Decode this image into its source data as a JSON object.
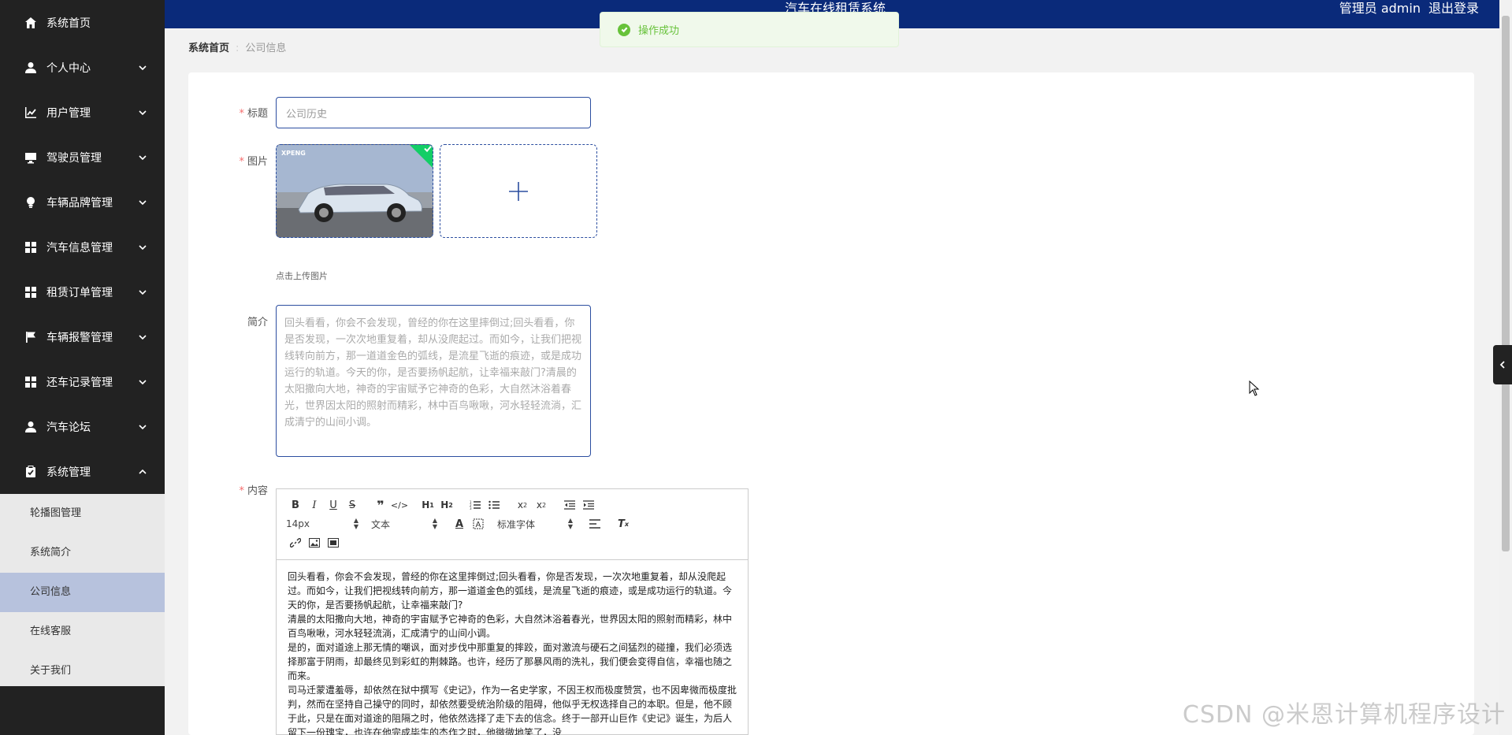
{
  "header": {
    "title": "汽车在线租赁系统",
    "user_label": "管理员 admin",
    "logout_label": "退出登录"
  },
  "sidebar": {
    "items": [
      {
        "label": "系统首页",
        "icon": "home-icon",
        "expandable": false
      },
      {
        "label": "个人中心",
        "icon": "user-icon",
        "expandable": true
      },
      {
        "label": "用户管理",
        "icon": "chart-icon",
        "expandable": true
      },
      {
        "label": "驾驶员管理",
        "icon": "monitor-icon",
        "expandable": true
      },
      {
        "label": "车辆品牌管理",
        "icon": "bulb-icon",
        "expandable": true
      },
      {
        "label": "汽车信息管理",
        "icon": "grid-icon",
        "expandable": true
      },
      {
        "label": "租赁订单管理",
        "icon": "grid-icon",
        "expandable": true
      },
      {
        "label": "车辆报警管理",
        "icon": "flag-icon",
        "expandable": true
      },
      {
        "label": "还车记录管理",
        "icon": "grid-icon",
        "expandable": true
      },
      {
        "label": "汽车论坛",
        "icon": "user-icon",
        "expandable": true
      },
      {
        "label": "系统管理",
        "icon": "clipboard-icon",
        "expandable": true,
        "expanded": true
      }
    ],
    "submenu": [
      {
        "label": "轮播图管理"
      },
      {
        "label": "系统简介"
      },
      {
        "label": "公司信息",
        "active": true
      },
      {
        "label": "在线客服"
      },
      {
        "label": "关于我们"
      }
    ]
  },
  "breadcrumb": {
    "home": "系统首页",
    "current": "公司信息"
  },
  "toast": {
    "message": "操作成功"
  },
  "form": {
    "title_label": "标题",
    "title_value": "公司历史",
    "image_label": "图片",
    "upload_tip": "点击上传图片",
    "image_logo": "XPENG",
    "intro_label": "简介",
    "intro_value": "回头看看，你会不会发现，曾经的你在这里摔倒过;回头看看，你是否发现，一次次地重复着，却从没爬起过。而如今，让我们把视线转向前方，那一道道金色的弧线，是流星飞逝的痕迹，或是成功运行的轨道。今天的你，是否要扬帆起航，让幸福来敲门?清晨的太阳撒向大地，神奇的宇宙赋予它神奇的色彩，大自然沐浴着春光，世界因太阳的照射而精彩，林中百鸟啾啾，河水轻轻流淌，汇成清宁的山间小调。",
    "content_label": "内容",
    "content_paragraphs": [
      "回头看看，你会不会发现，曾经的你在这里摔倒过;回头看看，你是否发现，一次次地重复着，却从没爬起过。而如今，让我们把视线转向前方，那一道道金色的弧线，是流星飞逝的痕迹，或是成功运行的轨道。今天的你，是否要扬帆起航，让幸福来敲门?",
      "清晨的太阳撒向大地，神奇的宇宙赋予它神奇的色彩，大自然沐浴着春光，世界因太阳的照射而精彩，林中百鸟啾啾，河水轻轻流淌，汇成清宁的山间小调。",
      "是的，面对道途上那无情的嘲讽，面对步伐中那重复的摔跤，面对激流与硬石之间猛烈的碰撞，我们必须选择那富于阴雨，却最终见到彩虹的荆棘路。也许，经历了那暴风雨的洗礼，我们便会变得自信，幸福也随之而来。",
      "司马迁蒙遭羞辱，却依然在狱中撰写《史记》，作为一名史学家，不因王权而极度赞赏，也不因卑微而极度批判，然而在坚持自己操守的同时，却依然要受统治阶级的阻碍，他似乎无权选择自己的本职。但是，他不顾于此，只是在面对道途的阻隔之时，他依然选择了走下去的信念。终于一部开山巨作《史记》诞生，为后人留下一份瑰宝，也许在他完成毕生的杰作之时，他微微地笑了，没"
    ]
  },
  "editor": {
    "font_size": "14px",
    "block_type": "文本",
    "font_family": "标准字体"
  },
  "watermark": "CSDN @米恩计算机程序设计"
}
